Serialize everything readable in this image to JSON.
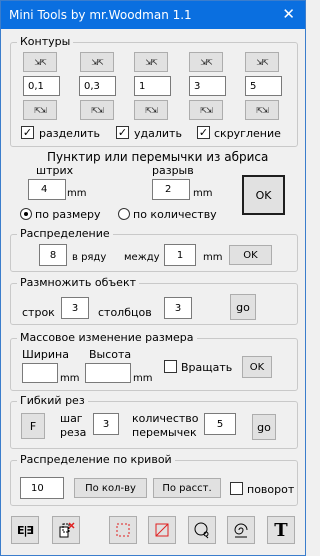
{
  "window": {
    "title": "Mini Tools by mr.Woodman 1.1",
    "close_glyph": "✕"
  },
  "contours": {
    "legend": "Контуры",
    "arrow_top": "⇲⇱",
    "arrow_bottom": "⇱⇲",
    "values": [
      "0,1",
      "0,3",
      "1",
      "3",
      "5"
    ],
    "split_label": "разделить",
    "split_checked": true,
    "delete_label": "удалить",
    "delete_checked": true,
    "round_label": "скругление",
    "round_checked": true
  },
  "dotted": {
    "heading": "Пунктир или перемычки из абриса",
    "stroke_label": "штрих",
    "stroke_value": "4",
    "stroke_unit": "mm",
    "gap_label": "разрыв",
    "gap_value": "2",
    "gap_unit": "mm",
    "ok_label": "OK",
    "by_size_label": "по размеру",
    "by_size_selected": true,
    "by_count_label": "по количеству",
    "by_count_selected": false
  },
  "distribution": {
    "legend": "Распределение",
    "per_row_value": "8",
    "per_row_label": "в ряду",
    "between_label": "между",
    "between_value": "1",
    "between_unit": "mm",
    "ok_label": "OK"
  },
  "multiply": {
    "legend": "Размножить объект",
    "rows_label": "строк",
    "rows_value": "3",
    "cols_label": "столбцов",
    "cols_value": "3",
    "go_label": "go"
  },
  "resize": {
    "legend": "Массовое изменение размера",
    "width_label": "Ширина",
    "width_value": "",
    "width_unit": "mm",
    "height_label": "Высота",
    "height_value": "",
    "height_unit": "mm",
    "rotate_label": "Вращать",
    "rotate_checked": false,
    "ok_label": "OK"
  },
  "flex_cut": {
    "legend": "Гибкий рез",
    "f_label": "F",
    "step_label_1": "шаг",
    "step_label_2": "реза",
    "step_value": "3",
    "count_label_1": "количество",
    "count_label_2": "перемычек",
    "count_value": "5",
    "go_label": "go"
  },
  "curve": {
    "legend": "Распределение по кривой",
    "value": "10",
    "by_count_label": "По кол-ву",
    "by_dist_label": "По расст.",
    "rotate_label": "поворот",
    "rotate_checked": false
  },
  "toolbar": {
    "icons": [
      "mirror-icon",
      "delete-object-icon",
      "dashed-rect-icon",
      "crossed-rect-icon",
      "circle-node-icon",
      "spiral-icon",
      "text-icon"
    ],
    "text_glyph": "T",
    "mirror_glyph": "E|∃"
  },
  "colors": {
    "titlebar": "#0a6fe0",
    "red": "#e02020",
    "window_bg": "#f0f0f0"
  }
}
